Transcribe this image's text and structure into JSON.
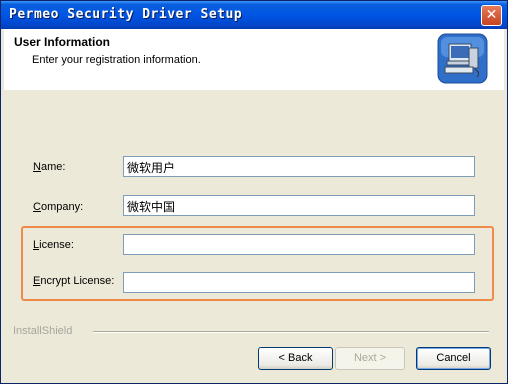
{
  "window": {
    "title": "Permeo Security Driver Setup",
    "close_glyph": "✕"
  },
  "header": {
    "title": "User Information",
    "subtitle": "Enter your registration information.",
    "icon": "computer-setup-icon"
  },
  "form": {
    "name_label": "Name:",
    "name_value": "微软用户",
    "company_label": "Company:",
    "company_value": "微软中国",
    "license_label": "License:",
    "license_value": "",
    "encrypt_label": "Encrypt License:",
    "encrypt_value": ""
  },
  "footer": {
    "brand": "InstallShield",
    "back_label": "< Back",
    "next_label": "Next >",
    "cancel_label": "Cancel"
  },
  "colors": {
    "highlight": "#f08a4b",
    "titlebar": "#0055e5"
  }
}
